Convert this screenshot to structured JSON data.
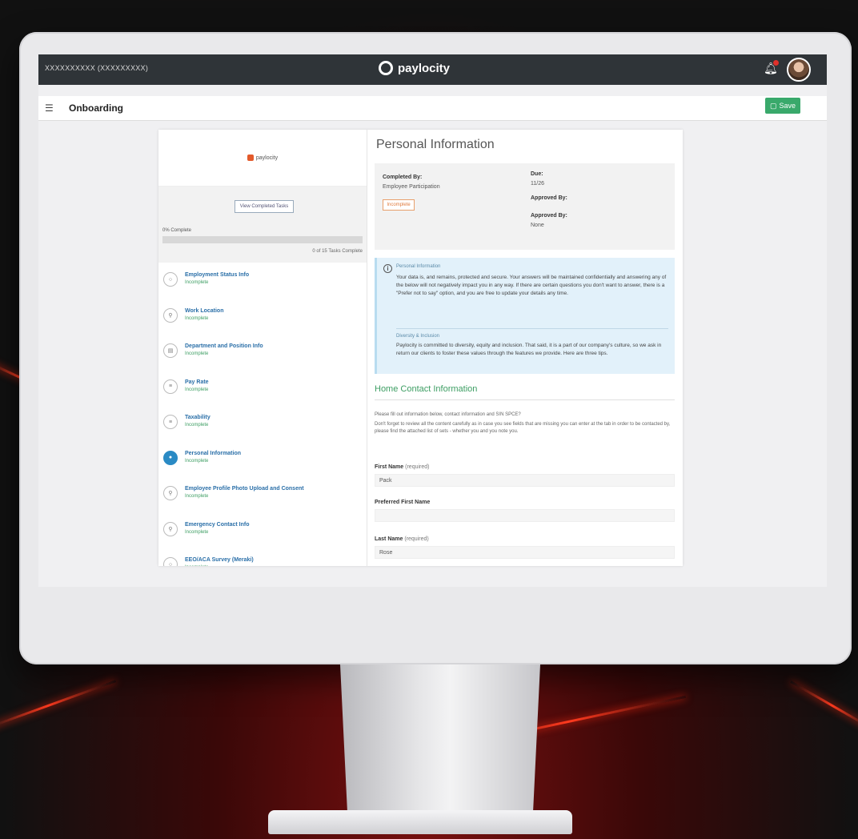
{
  "topbar": {
    "company": "XXXXXXXXXX (XXXXXXXXX)",
    "brand": "paylocity",
    "bell_icon": "bell-icon",
    "notification_color": "#e0312b"
  },
  "subbar": {
    "title": "Onboarding",
    "save_label": "Save",
    "accent": "#39a96b"
  },
  "left_panel": {
    "logo_text": "paylocity",
    "view_button": "View Completed Tasks",
    "percent_label": "0% Complete",
    "progress_fraction": 0.0,
    "progress_count": "0 of 15 Tasks Complete",
    "tasks": [
      {
        "name": "Employment Status Info",
        "status": "Incomplete",
        "icon": "circle-check-icon",
        "glyph": "○"
      },
      {
        "name": "Work Location",
        "status": "Incomplete",
        "icon": "location-icon",
        "glyph": "⚲"
      },
      {
        "name": "Department and Position Info",
        "status": "Incomplete",
        "icon": "briefcase-icon",
        "glyph": "▤"
      },
      {
        "name": "Pay Rate",
        "status": "Incomplete",
        "icon": "document-icon",
        "glyph": "≡"
      },
      {
        "name": "Taxability",
        "status": "Incomplete",
        "icon": "document-icon",
        "glyph": "≡"
      },
      {
        "name": "Personal Information",
        "status": "Incomplete",
        "icon": "person-icon",
        "glyph": "●"
      },
      {
        "name": "Employee Profile Photo Upload and Consent",
        "status": "Incomplete",
        "icon": "person-icon",
        "glyph": "⚲"
      },
      {
        "name": "Emergency Contact Info",
        "status": "Incomplete",
        "icon": "person-icon",
        "glyph": "⚲"
      },
      {
        "name": "EEO/ACA Survey (Meraki)",
        "status": "Incomplete",
        "icon": "survey-icon",
        "glyph": "○"
      }
    ]
  },
  "right_panel": {
    "title": "Personal Information",
    "completed_by_label": "Completed By:",
    "completed_by_value": "Employee Participation",
    "status_tag": "Incomplete",
    "due_label": "Due:",
    "due_value": "11/26",
    "approved_by_label": "Approved By:",
    "approved_by_label2": "Approved By:",
    "approved_by_value": "None",
    "info_heading1": "Personal Information",
    "info_text1": "Your data is, and remains, protected and secure. Your answers will be maintained confidentially and answering any of the below will not negatively impact you in any way. If there are certain questions you don't want to answer, there is a \"Prefer not to say\" option, and you are free to update your details any time.",
    "info_heading2": "Diversity & Inclusion",
    "info_text2": "Paylocity is committed to diversity, equity and inclusion. That said, it is a part of our company's culture, so we ask in return our clients to foster these values through the features we provide. Here are three tips.",
    "contact_title": "Home Contact Information",
    "intro1": "Please fill out information below, contact information and SIN SPCE?",
    "intro2": "Don't forget to review all the content carefully as in case you see fields that are missing you can enter at the tab in order to be contacted by, please find the attached list of sets - whether you and you note you.",
    "first_name_label": "First Name",
    "first_name_req": "(required)",
    "first_name_value": "Pack",
    "preferred_label": "Preferred First Name",
    "preferred_value": "",
    "last_name_label": "Last Name",
    "last_name_req": "(required)",
    "last_name_value": "Rose"
  }
}
